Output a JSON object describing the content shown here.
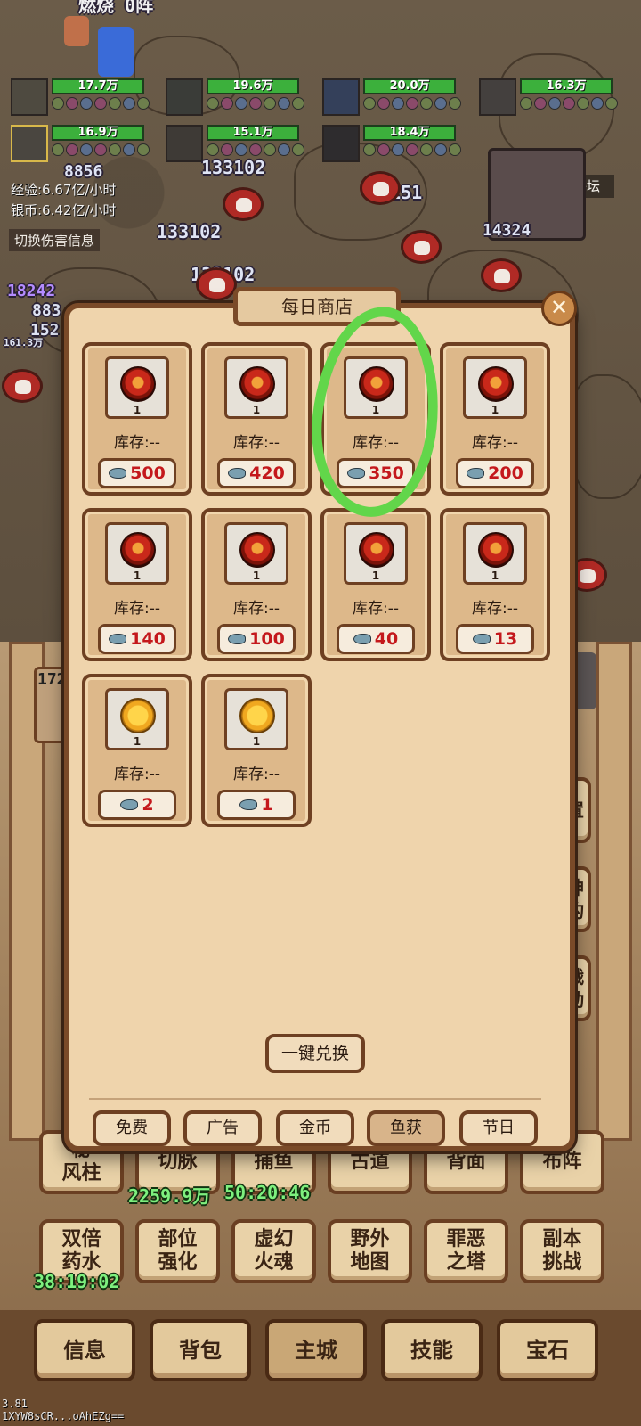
{
  "battle": {
    "banner_partial": "燃烧 0阵",
    "heroes": [
      {
        "hp": "17.7万"
      },
      {
        "hp": "19.6万"
      },
      {
        "hp": "20.0万"
      },
      {
        "hp": "16.3万"
      },
      {
        "hp": "16.9万"
      },
      {
        "hp": "15.1万"
      },
      {
        "hp": "18.4万"
      }
    ],
    "exp_rate": "经验:6.67亿/小时",
    "silver_rate": "银币:6.42亿/小时",
    "toggle_damage_info": "切换伤害信息",
    "map_name": "龙语祭坛",
    "damage_numbers": [
      "8856",
      "133102",
      "25151",
      "14324",
      "133102",
      "133102",
      "18242",
      "883",
      "152",
      "161.3万"
    ]
  },
  "town": {
    "side_label": "172",
    "buttons_row1": [
      "秘\n风柱",
      "切脉",
      "捕鱼",
      "古道",
      "背面",
      "布阵"
    ],
    "buttons_row2": [
      "双倍\n药水",
      "部位\n强化",
      "虚幻\n火魂",
      "野外\n地图",
      "罪恶\n之塔",
      "副本\n挑战"
    ],
    "timers": {
      "potion": "38:19:02",
      "qiemai": "2259.9万",
      "fishing": "50:20:46"
    },
    "right_glyphs": [
      "置",
      "神\n灼",
      "战\n动"
    ]
  },
  "shop": {
    "title": "每日商店",
    "close_label": "✕",
    "items": [
      {
        "qty": "1",
        "stock": "库存:--",
        "price": "500",
        "cost_icon": "fish-icon"
      },
      {
        "qty": "1",
        "stock": "库存:--",
        "price": "420",
        "cost_icon": "pufferfish-icon"
      },
      {
        "qty": "1",
        "stock": "库存:--",
        "price": "350",
        "cost_icon": "dried-fish-icon"
      },
      {
        "qty": "1",
        "stock": "库存:--",
        "price": "200",
        "cost_icon": "starfish-icon"
      },
      {
        "qty": "1",
        "stock": "库存:--",
        "price": "140",
        "cost_icon": "turtle-icon"
      },
      {
        "qty": "1",
        "stock": "库存:--",
        "price": "100",
        "cost_icon": "shark-icon"
      },
      {
        "qty": "1",
        "stock": "库存:--",
        "price": "40",
        "cost_icon": "shrimp-icon"
      },
      {
        "qty": "1",
        "stock": "库存:--",
        "price": "13",
        "cost_icon": "small-fish-icon"
      },
      {
        "qty": "1",
        "stock": "库存:--",
        "price": "2",
        "cost_icon": "red-fish-icon"
      },
      {
        "qty": "1",
        "stock": "库存:--",
        "price": "1",
        "cost_icon": "eel-icon"
      }
    ],
    "exchange_all": "一键兑换",
    "tabs": [
      "免费",
      "广告",
      "金币",
      "鱼获",
      "节日"
    ],
    "active_tab": "鱼获",
    "highlight_color": "#62d64a"
  },
  "nav": {
    "items": [
      "信息",
      "背包",
      "主城",
      "技能",
      "宝石"
    ],
    "active": "主城"
  },
  "debug": {
    "version": "3.81",
    "id": "1XYW8sCR...oAhEZg=="
  }
}
